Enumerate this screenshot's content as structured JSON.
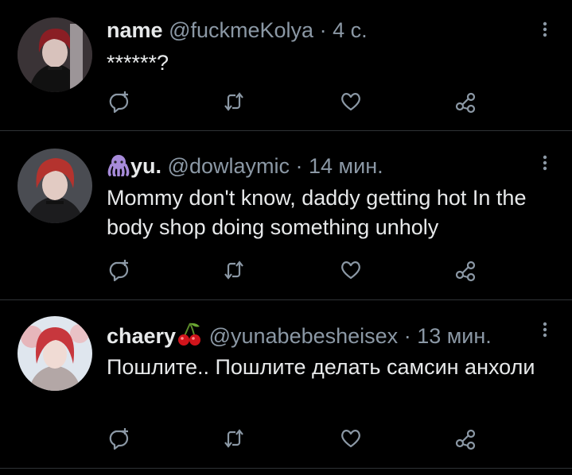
{
  "tweets": [
    {
      "display_name": "name",
      "handle": "@fuckmeKolya",
      "separator": "·",
      "time": "4 с.",
      "text": "******?",
      "avatar_color": "#8a1e24"
    },
    {
      "display_name": "yu.",
      "name_emoji": "octopus",
      "handle": "@dowlaymic",
      "separator": "·",
      "time": "14 мин.",
      "text": "Mommy don't know, daddy getting hot In the body shop doing something unholy",
      "avatar_color": "#b4332e"
    },
    {
      "display_name": "chaery",
      "name_emoji": "cherries",
      "handle": "@yunabebesheisex",
      "separator": "·",
      "time": "13 мин.",
      "text": "Пошлите.. Пошлите делать самсин анхоли",
      "avatar_color": "#c7373d"
    }
  ],
  "icons": {
    "reply": "reply-icon",
    "retweet": "retweet-icon",
    "like": "heart-icon",
    "share": "share-icon",
    "more": "more-icon"
  },
  "colors": {
    "background": "#000000",
    "text": "#e7e9ea",
    "muted": "#8b98a5",
    "divider": "#2f3336",
    "octopus": "#a78bda",
    "cherry": "#d0141b"
  }
}
